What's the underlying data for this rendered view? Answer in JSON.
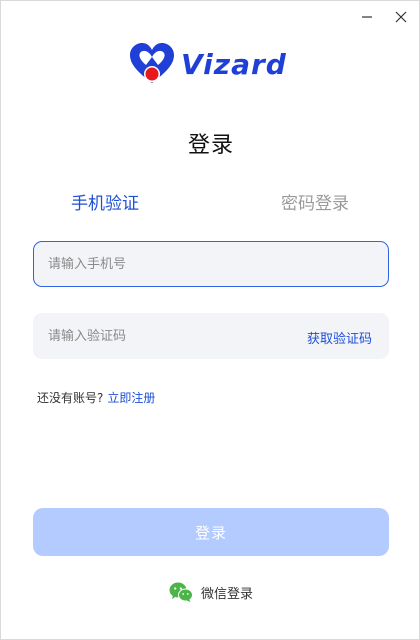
{
  "window": {
    "minimize_icon": "minimize-icon",
    "close_icon": "close-icon"
  },
  "brand": {
    "name": "Vizard",
    "color": "#1f3fd6",
    "accent_red": "#e8191b"
  },
  "page": {
    "title": "登录"
  },
  "tabs": [
    {
      "label": "手机验证",
      "active": true
    },
    {
      "label": "密码登录",
      "active": false
    }
  ],
  "form": {
    "phone_placeholder": "请输入手机号",
    "code_placeholder": "请输入验证码",
    "get_code_label": "获取验证码"
  },
  "register": {
    "prompt": "还没有账号?",
    "link": "立即注册"
  },
  "login_button": {
    "label": "登录",
    "color": "#b3cbff"
  },
  "wechat": {
    "label": "微信登录",
    "icon": "wechat-icon",
    "color": "#4bb54a"
  },
  "colors": {
    "primary": "#1f4fd8",
    "input_bg": "#f3f4f7",
    "input_focus_border": "#2f62e6"
  }
}
